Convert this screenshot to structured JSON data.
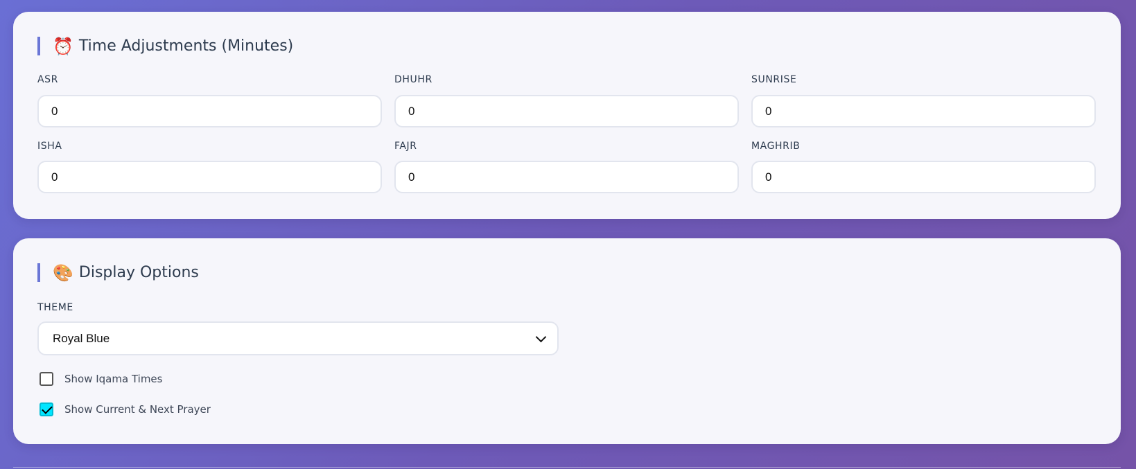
{
  "time_adjustments": {
    "icon": "alarm-clock-icon",
    "icon_glyph": "⏰",
    "title": "Time Adjustments (Minutes)",
    "fields": [
      {
        "label": "ASR",
        "value": "0"
      },
      {
        "label": "DHUHR",
        "value": "0"
      },
      {
        "label": "SUNRISE",
        "value": "0"
      },
      {
        "label": "ISHA",
        "value": "0"
      },
      {
        "label": "FAJR",
        "value": "0"
      },
      {
        "label": "MAGHRIB",
        "value": "0"
      }
    ]
  },
  "display_options": {
    "icon": "palette-icon",
    "icon_glyph": "🎨",
    "title": "Display Options",
    "theme": {
      "label": "THEME",
      "selected": "Royal Blue"
    },
    "checkboxes": [
      {
        "label": "Show Iqama Times",
        "checked": false
      },
      {
        "label": "Show Current & Next Prayer",
        "checked": true
      }
    ]
  },
  "colors": {
    "accent": "#6a76d6",
    "checkbox_checked": "#00e5ff",
    "card_background": "#f6f6fb",
    "title_text": "#2d3b4e"
  }
}
